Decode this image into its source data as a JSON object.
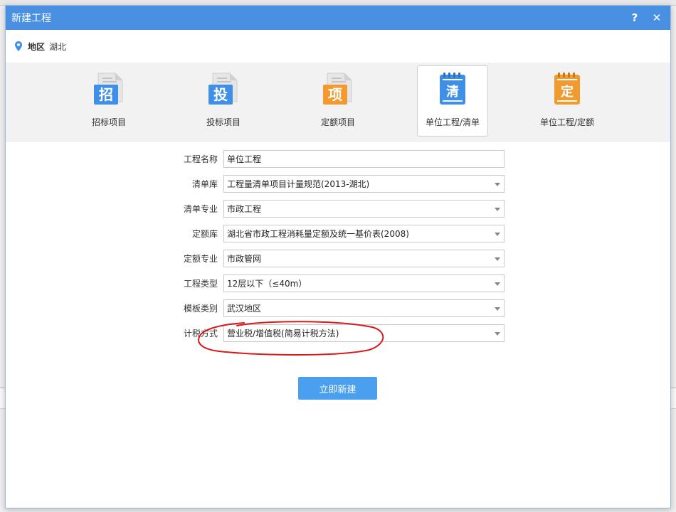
{
  "dialog": {
    "title": "新建工程",
    "help_symbol": "?",
    "close_symbol": "✕"
  },
  "region": {
    "label": "地区",
    "value": "湖北"
  },
  "project_types": [
    {
      "glyph": "招",
      "label": "招标项目",
      "color": "#3e8fe8"
    },
    {
      "glyph": "投",
      "label": "投标项目",
      "color": "#3e8fe8"
    },
    {
      "glyph": "项",
      "label": "定额项目",
      "color": "#f29a2e"
    },
    {
      "glyph": "清",
      "label": "单位工程/清单",
      "color": "#3e8fe8",
      "selected": true
    },
    {
      "glyph": "定",
      "label": "单位工程/定额",
      "color": "#f29a2e"
    }
  ],
  "form": {
    "project_name": {
      "label": "工程名称",
      "value": "单位工程"
    },
    "bill_library": {
      "label": "清单库",
      "value": "工程量清单项目计量规范(2013-湖北)"
    },
    "bill_specialty": {
      "label": "清单专业",
      "value": "市政工程"
    },
    "quota_library": {
      "label": "定额库",
      "value": "湖北省市政工程消耗量定额及统一基价表(2008)"
    },
    "quota_specialty": {
      "label": "定额专业",
      "value": "市政管网"
    },
    "project_category": {
      "label": "工程类型",
      "value": "12层以下（≤40m）"
    },
    "template_category": {
      "label": "模板类别",
      "value": "武汉地区"
    },
    "tax_method": {
      "label": "计税方式",
      "value": "营业税/增值税(简易计税方法)"
    }
  },
  "actions": {
    "create_label": "立即新建"
  },
  "colors": {
    "titlebar": "#4a90e2",
    "accent_button": "#4a9fef",
    "annotation": "#d9191b"
  }
}
